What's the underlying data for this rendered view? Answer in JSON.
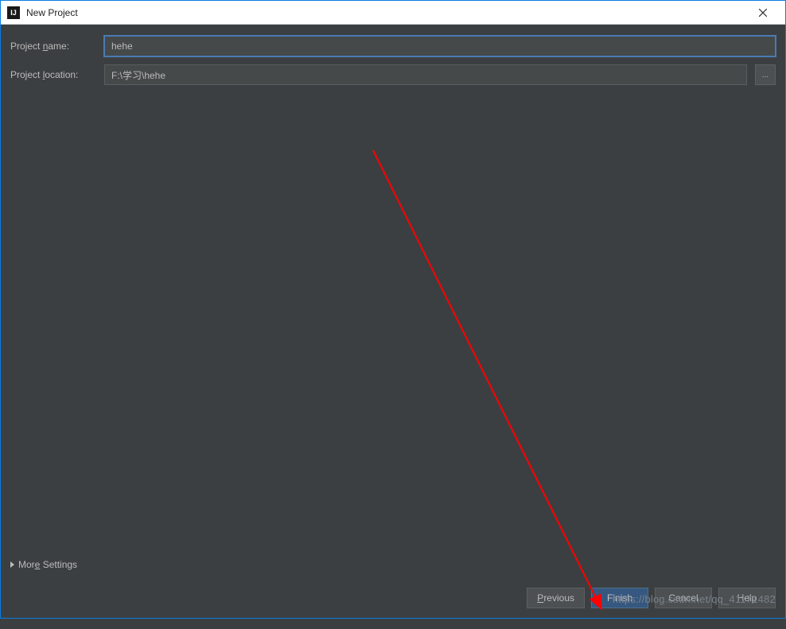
{
  "window": {
    "title": "New Project",
    "app_icon_text": "IJ"
  },
  "form": {
    "project_name_label_pre": "Project ",
    "project_name_label_u": "n",
    "project_name_label_post": "ame:",
    "project_name_value": "hehe",
    "project_location_label_pre": "Project ",
    "project_location_label_u": "l",
    "project_location_label_post": "ocation:",
    "project_location_value": "F:\\学习\\hehe",
    "browse_label": "..."
  },
  "more_settings": {
    "label_pre": "Mor",
    "label_u": "e",
    "label_post": " Settings"
  },
  "buttons": {
    "previous_pre": "",
    "previous_u": "P",
    "previous_post": "revious",
    "finish": "Finish",
    "cancel": "Cancel",
    "help": "Help"
  },
  "watermark": "https://blog.csdn.net/qq_41171482"
}
